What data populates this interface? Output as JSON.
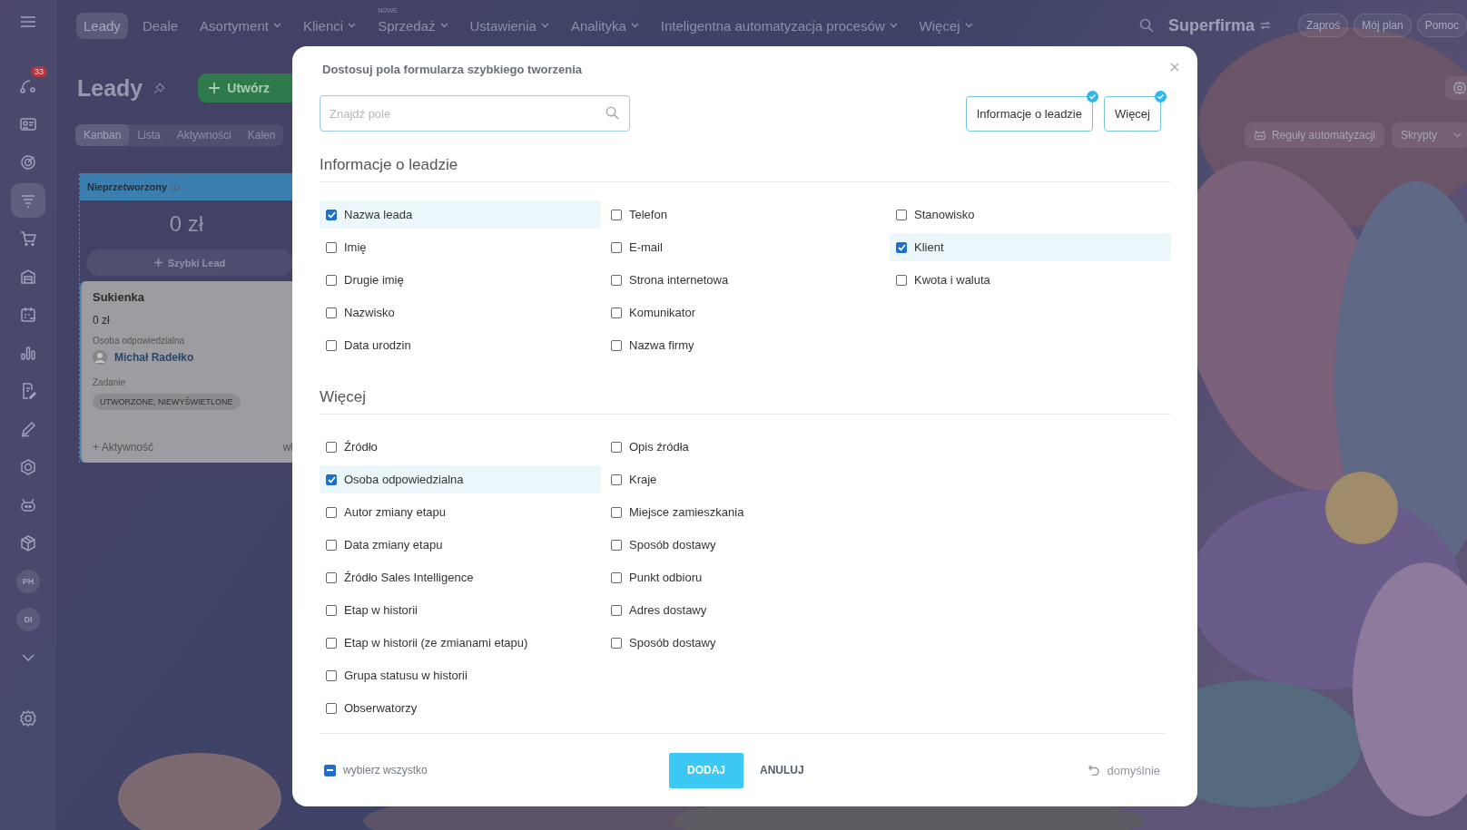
{
  "top_nav": {
    "items": [
      {
        "label": "Leady",
        "selected": true,
        "dropdown": false
      },
      {
        "label": "Deale",
        "selected": false,
        "dropdown": false
      },
      {
        "label": "Asortyment",
        "selected": false,
        "dropdown": true
      },
      {
        "label": "Klienci",
        "selected": false,
        "dropdown": true
      },
      {
        "label": "Sprzedaż",
        "selected": false,
        "dropdown": true,
        "badge": "NOWE"
      },
      {
        "label": "Ustawienia",
        "selected": false,
        "dropdown": true
      },
      {
        "label": "Analityka",
        "selected": false,
        "dropdown": true
      },
      {
        "label": "Inteligentna automatyzacja procesów",
        "selected": false,
        "dropdown": true
      },
      {
        "label": "Więcej",
        "selected": false,
        "dropdown": true
      }
    ],
    "company": "Superfirma",
    "buttons": [
      "Zaproś",
      "Mój plan",
      "Pomoc"
    ]
  },
  "sidebar": {
    "items": [
      {
        "kind": "chat",
        "selected": false,
        "badge": "33"
      },
      {
        "kind": "card",
        "selected": false
      },
      {
        "kind": "target",
        "selected": false
      },
      {
        "kind": "funnel",
        "selected": true
      },
      {
        "kind": "cart",
        "selected": false
      },
      {
        "kind": "warehouse",
        "selected": false
      },
      {
        "kind": "calendar",
        "selected": false
      },
      {
        "kind": "chart",
        "selected": false
      },
      {
        "kind": "document",
        "selected": false
      },
      {
        "kind": "pen",
        "selected": false
      },
      {
        "kind": "hexagon",
        "selected": false
      },
      {
        "kind": "robot",
        "selected": false
      },
      {
        "kind": "box",
        "selected": false
      },
      {
        "kind": "avatar",
        "selected": false,
        "label": "PH"
      },
      {
        "kind": "avatar",
        "selected": false,
        "label": "DI"
      },
      {
        "kind": "more",
        "selected": false
      }
    ]
  },
  "page": {
    "title": "Leady",
    "create_button": "Utwórz",
    "view_tabs": [
      {
        "label": "Kanban",
        "selected": true
      },
      {
        "label": "Lista",
        "selected": false
      },
      {
        "label": "Aktywności",
        "selected": false
      },
      {
        "label": "Kalen",
        "selected": false
      }
    ],
    "actions": [
      "Reguły automatyzacji",
      "Skrypty"
    ],
    "kanban": {
      "stage": "Nieprzetworzony",
      "count": "(1)",
      "color": "#3a7fb0",
      "total": "0 zł",
      "quick_add": "Szybki Lead",
      "card": {
        "title": "Sukienka",
        "amount": "0 zł",
        "responsible_label": "Osoba odpowiedzialna",
        "responsible": "Michał Radełko",
        "task_label": "Zadanie",
        "task_status": "UTWORZONE, NIEWYŚWIETLONE",
        "activity": "+ Aktywność",
        "column_2": "wł"
      }
    }
  },
  "modal": {
    "title": "Dostosuj pola formularza szybkiego tworzenia",
    "search": {
      "placeholder": "Znajdź pole"
    },
    "filters": [
      {
        "label": "Informacje o leadzie",
        "checked": true
      },
      {
        "label": "Więcej",
        "checked": true
      }
    ],
    "sections": [
      {
        "title": "Informacje o leadzie",
        "columns": [
          [
            {
              "label": "Nazwa leada",
              "checked": true
            },
            {
              "label": "Imię",
              "checked": false
            },
            {
              "label": "Drugie imię",
              "checked": false
            },
            {
              "label": "Nazwisko",
              "checked": false
            },
            {
              "label": "Data urodzin",
              "checked": false
            }
          ],
          [
            {
              "label": "Telefon",
              "checked": false
            },
            {
              "label": "E-mail",
              "checked": false
            },
            {
              "label": "Strona internetowa",
              "checked": false
            },
            {
              "label": "Komunikator",
              "checked": false
            },
            {
              "label": "Nazwa firmy",
              "checked": false
            }
          ],
          [
            {
              "label": "Stanowisko",
              "checked": false
            },
            {
              "label": "Klient",
              "checked": true
            },
            {
              "label": "Kwota i waluta",
              "checked": false
            }
          ]
        ]
      },
      {
        "title": "Więcej",
        "columns": [
          [
            {
              "label": "Źródło",
              "checked": false
            },
            {
              "label": "Osoba odpowiedzialna",
              "checked": true
            },
            {
              "label": "Autor zmiany etapu",
              "checked": false
            },
            {
              "label": "Data zmiany etapu",
              "checked": false
            },
            {
              "label": "Źródło Sales Intelligence",
              "checked": false
            },
            {
              "label": "Etap w historii",
              "checked": false
            },
            {
              "label": "Etap w historii (ze zmianami etapu)",
              "checked": false
            },
            {
              "label": "Grupa statusu w historii",
              "checked": false
            },
            {
              "label": "Obserwatorzy",
              "checked": false
            }
          ],
          [
            {
              "label": "Opis źródła",
              "checked": false
            },
            {
              "label": "Kraje",
              "checked": false
            },
            {
              "label": "Miejsce zamieszkania",
              "checked": false
            },
            {
              "label": "Sposób dostawy",
              "checked": false
            },
            {
              "label": "Punkt odbioru",
              "checked": false
            },
            {
              "label": "Adres dostawy",
              "checked": false
            },
            {
              "label": "Sposób dostawy",
              "checked": false
            }
          ]
        ]
      }
    ],
    "select_all": {
      "label": "wybierz wszystko",
      "indeterminate": true
    },
    "primary_button": "DODAJ",
    "cancel_button": "ANULUJ",
    "reset_link": "domyślnie"
  }
}
